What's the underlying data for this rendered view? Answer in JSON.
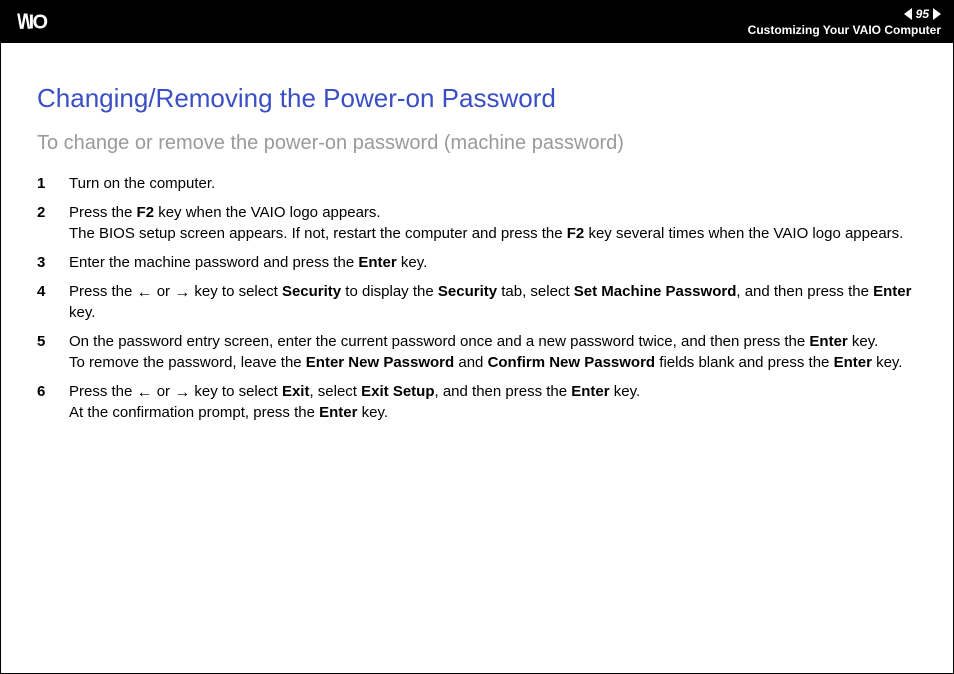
{
  "header": {
    "page_number": "95",
    "chapter_title": "Customizing Your VAIO Computer"
  },
  "title": "Changing/Removing the Power-on Password",
  "subtitle": "To change or remove the power-on password (machine password)",
  "steps": [
    {
      "n": "1",
      "html": "Turn on the computer."
    },
    {
      "n": "2",
      "html": "Press the <span class='b'>F2</span> key when the VAIO logo appears.<br>The BIOS setup screen appears. If not, restart the computer and press the <span class='b'>F2</span> key several times when the VAIO logo appears."
    },
    {
      "n": "3",
      "html": "Enter the machine password and press the <span class='b'>Enter</span> key."
    },
    {
      "n": "4",
      "html": "Press the <span class='arrow'>&#8592;</span> or <span class='arrow'>&#8594;</span> key to select <span class='b'>Security</span> to display the <span class='b'>Security</span> tab, select <span class='b'>Set Machine Password</span>, and then press the <span class='b'>Enter</span> key."
    },
    {
      "n": "5",
      "html": "On the password entry screen, enter the current password once and a new password twice, and then press the <span class='b'>Enter</span> key.<br>To remove the password, leave the <span class='b'>Enter New Password</span> and <span class='b'>Confirm New Password</span> fields blank and press the <span class='b'>Enter</span> key."
    },
    {
      "n": "6",
      "html": "Press the <span class='arrow'>&#8592;</span> or <span class='arrow'>&#8594;</span> key to select <span class='b'>Exit</span>, select <span class='b'>Exit Setup</span>, and then press the <span class='b'>Enter</span> key.<br>At the confirmation prompt, press the <span class='b'>Enter</span> key."
    }
  ],
  "frame_letter": "n  N"
}
